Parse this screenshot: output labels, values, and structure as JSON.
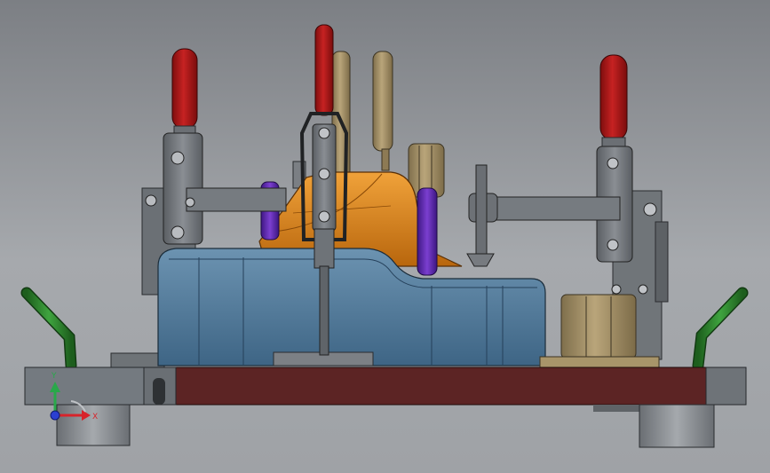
{
  "view": {
    "background_top": "#7c7f84",
    "background_bottom": "#a6a9ad"
  },
  "triad": {
    "x_label": "X",
    "y_label": "Y",
    "x_color": "#d8232a",
    "y_color": "#29a84a",
    "z_color": "#2b3fd1"
  },
  "colors": {
    "clamp_handle": "#b01919",
    "support_pin": "#a8956a",
    "locator_pin": "#6a2fb5",
    "part": "#e08a1e",
    "block": "#4f7896",
    "base_plate": "#5a2424",
    "frame": "#6e7378",
    "lift_handle": "#2f8a2f"
  }
}
